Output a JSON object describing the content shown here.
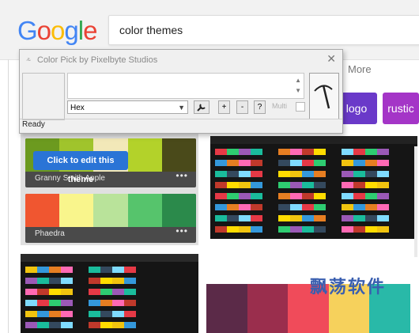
{
  "browser": {
    "logo": "Google",
    "search_query": "color themes",
    "more_label": "More"
  },
  "chips": [
    {
      "label": "logo",
      "color": "#6a39c9"
    },
    {
      "label": "rustic",
      "color": "#a435c7"
    }
  ],
  "palettes": [
    {
      "name": "Granny Smith Apple",
      "colors": [
        "#6c9a1f",
        "#a0c42c",
        "#f2e8b8",
        "#b3d22a",
        "#4a4a1a"
      ],
      "menu": "•••"
    },
    {
      "name": "Phaedra",
      "colors": [
        "#f05630",
        "#f9f58c",
        "#b9e39a",
        "#56c46c",
        "#2b8a4b"
      ],
      "menu": "•••"
    }
  ],
  "tooltip": "Click to edit this theme",
  "big_swatch": [
    "#5b2a48",
    "#9a2e4d",
    "#f04b5a",
    "#f6d15c",
    "#29b9a8"
  ],
  "watermark": "飘荡软件",
  "dialog": {
    "title": "Color Pick by Pixelbyte Studios",
    "format_value": "Hex",
    "plus_label": "+",
    "minus_label": "-",
    "help_label": "?",
    "multi_label": "Multi",
    "status": "Ready"
  }
}
